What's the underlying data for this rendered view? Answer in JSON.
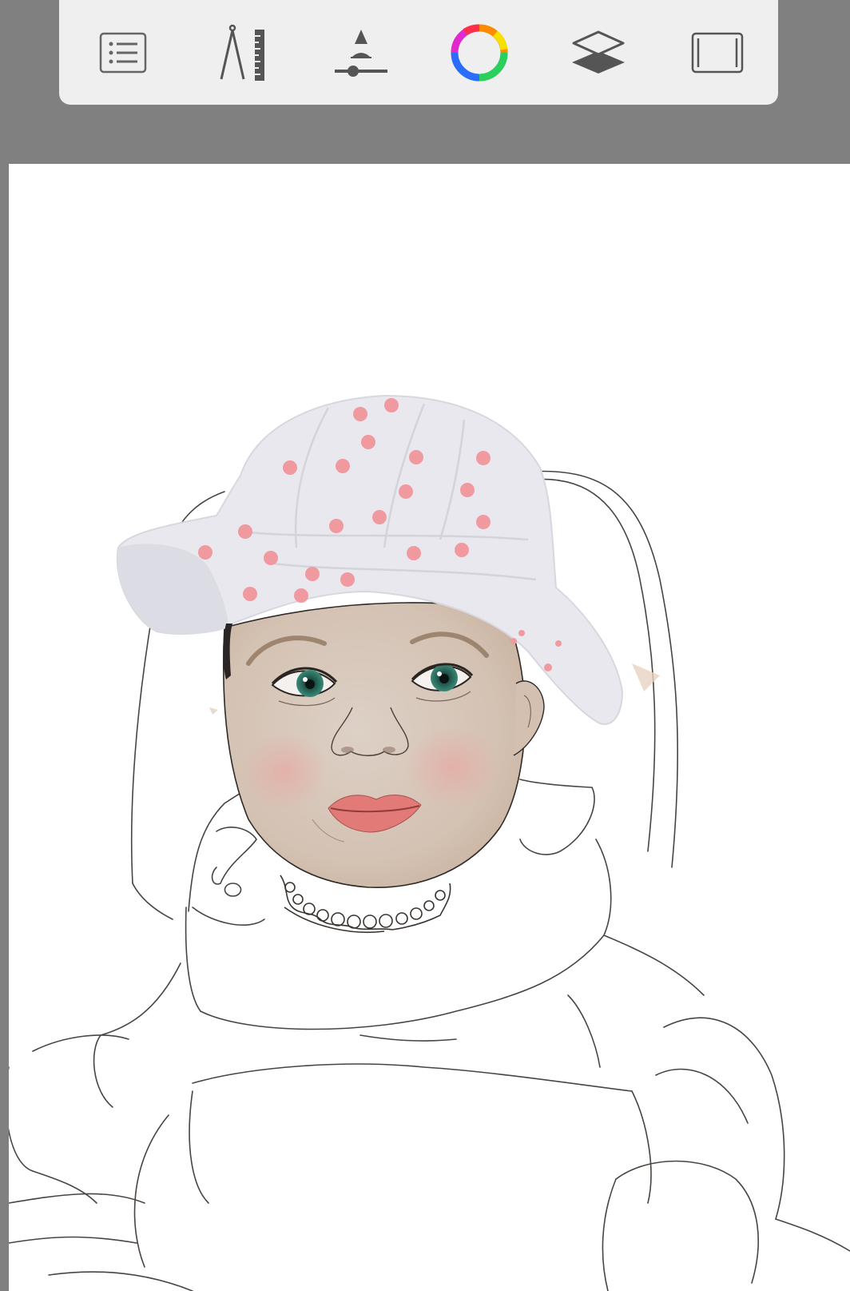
{
  "app": {
    "background": "#808080",
    "toolbar_background": "#efefef",
    "canvas_background": "#ffffff"
  },
  "toolbar": {
    "items": [
      {
        "name": "menu",
        "icon": "list-icon"
      },
      {
        "name": "guides",
        "icon": "compass-ruler-icon"
      },
      {
        "name": "brush",
        "icon": "brush-size-icon"
      },
      {
        "name": "color",
        "icon": "color-wheel-icon"
      },
      {
        "name": "layers",
        "icon": "layers-icon"
      },
      {
        "name": "canvas",
        "icon": "canvas-frame-icon"
      }
    ]
  },
  "drawing": {
    "subject": "baby-portrait-sketch",
    "colors": {
      "hat": "#e7e7ee",
      "hat_dots": "#f09aa0",
      "skin": "#d9c8bb",
      "cheek": "#e6b2aa",
      "lips": "#e27b78",
      "iris": "#2f7d6a",
      "line": "#4a4440"
    }
  }
}
